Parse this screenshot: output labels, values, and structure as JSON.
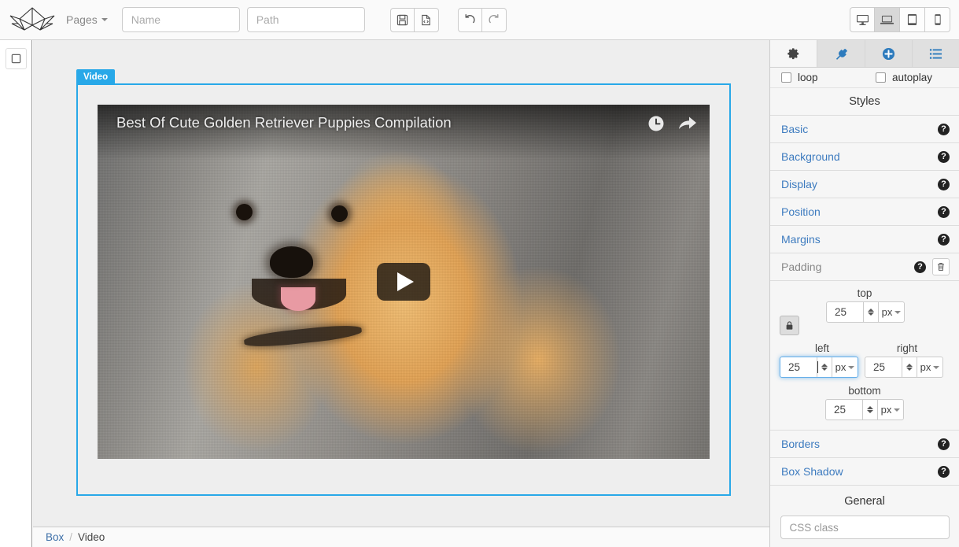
{
  "topbar": {
    "logo_name": "origami-logo",
    "pages_label": "Pages",
    "name_placeholder": "Name",
    "path_placeholder": "Path",
    "name_value": "",
    "path_value": "",
    "buttons": [
      {
        "name": "save-button",
        "icon": "floppy-disk-icon",
        "title": "Save"
      },
      {
        "name": "export-code-button",
        "icon": "file-code-icon",
        "title": "Export"
      },
      {
        "name": "undo-button",
        "icon": "undo-icon",
        "title": "Undo"
      },
      {
        "name": "redo-button",
        "icon": "redo-icon",
        "title": "Redo"
      }
    ],
    "devices": [
      {
        "name": "device-desktop",
        "icon": "desktop-icon",
        "label": "Desktop",
        "active": false
      },
      {
        "name": "device-laptop",
        "icon": "laptop-icon",
        "label": "Laptop",
        "active": true
      },
      {
        "name": "device-tablet",
        "icon": "tablet-icon",
        "label": "Tablet",
        "active": false
      },
      {
        "name": "device-mobile",
        "icon": "mobile-icon",
        "label": "Mobile",
        "active": false
      }
    ]
  },
  "leftrail": {
    "blocks_icon": "square-box-icon"
  },
  "canvas": {
    "selected_badge": "Video",
    "player": {
      "title": "Best Of Cute Golden Retriever Puppies Compilation",
      "watch_later_icon": "clock-icon",
      "share_icon": "share-arrow-icon",
      "play_icon": "play-triangle-icon"
    }
  },
  "breadcrumb": {
    "parent": "Box",
    "separator": "/",
    "current": "Video"
  },
  "rightpanel": {
    "tabs": [
      {
        "name": "tab-settings",
        "icon": "gear-icon",
        "label": "Settings",
        "active": true
      },
      {
        "name": "tab-traits",
        "icon": "plug-icon",
        "label": "Traits",
        "active": false
      },
      {
        "name": "tab-add",
        "icon": "plus-circle-icon",
        "label": "Add",
        "active": false
      },
      {
        "name": "tab-layers",
        "icon": "list-icon",
        "label": "Layers",
        "active": false
      }
    ],
    "checkboxes": [
      {
        "name": "checkbox-loop",
        "label": "loop",
        "checked": false
      },
      {
        "name": "checkbox-autoplay",
        "label": "autoplay",
        "checked": false
      }
    ],
    "styles_heading": "Styles",
    "style_sections": [
      {
        "name": "style-section-basic",
        "label": "Basic",
        "open": false
      },
      {
        "name": "style-section-background",
        "label": "Background",
        "open": false
      },
      {
        "name": "style-section-display",
        "label": "Display",
        "open": false
      },
      {
        "name": "style-section-position",
        "label": "Position",
        "open": false
      },
      {
        "name": "style-section-margins",
        "label": "Margins",
        "open": false
      },
      {
        "name": "style-section-padding",
        "label": "Padding",
        "open": true
      }
    ],
    "style_sections_after": [
      {
        "name": "style-section-borders",
        "label": "Borders",
        "open": false
      },
      {
        "name": "style-section-boxshadow",
        "label": "Box Shadow",
        "open": false
      }
    ],
    "help_icon": "question-mark-icon",
    "clear_icon": "trash-icon",
    "padding": {
      "lock_icon": "lock-icon",
      "top": {
        "label": "top",
        "value": "25",
        "unit": "px",
        "focused": false
      },
      "left": {
        "label": "left",
        "value": "25",
        "unit": "px",
        "focused": true
      },
      "right": {
        "label": "right",
        "value": "25",
        "unit": "px",
        "focused": false
      },
      "bottom": {
        "label": "bottom",
        "value": "25",
        "unit": "px",
        "focused": false
      }
    },
    "general_heading": "General",
    "css_class_placeholder": "CSS class",
    "css_class_value": ""
  },
  "colors": {
    "accent_blue": "#28a8e8",
    "link_blue": "#3d7bbf",
    "tab_blue": "#2d7bbd",
    "panel_bg": "#f6f6f6",
    "canvas_bg": "#eeeeee",
    "topbar_bg": "#fafafa"
  }
}
